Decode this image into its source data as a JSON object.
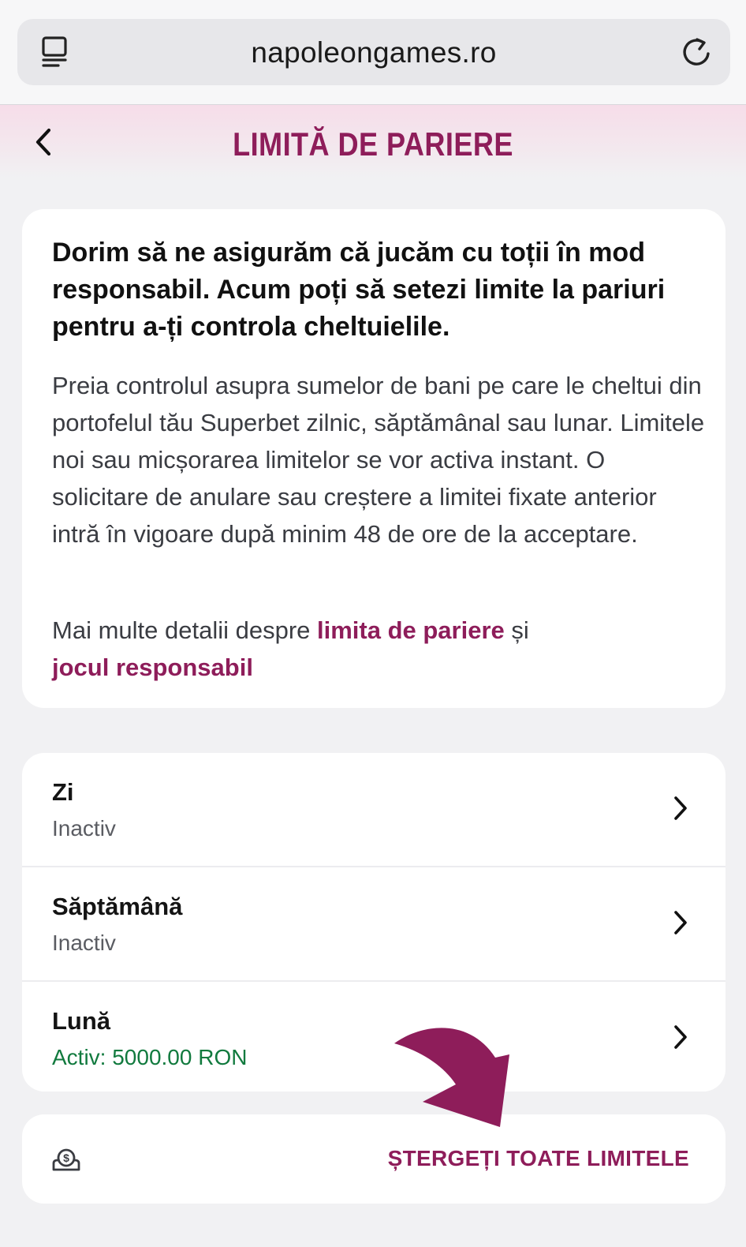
{
  "browser": {
    "url": "napoleongames.ro",
    "tabs_icon": "tabs-icon",
    "reload_icon": "reload-icon"
  },
  "header": {
    "title": "LIMITĂ DE PARIERE",
    "back_icon": "chevron-left-icon",
    "accent_color": "#8e1d5a"
  },
  "info": {
    "heading": "Dorim să ne asigurăm că jucăm cu toții în mod responsabil. Acum poți să setezi limite la pariuri pentru a-ți controla cheltuielile.",
    "body": "Preia controlul asupra sumelor de bani pe care le cheltui din portofelul tău Superbet zilnic, săptămânal sau lunar. Limitele noi sau micșorarea limitelor se vor activa instant. O solicitare de anulare sau creștere a limitei fixate anterior intră în vigoare după minim 48 de ore de la acceptare.",
    "more_prefix": "Mai multe detalii despre ",
    "link_betting_limit": "limita de pariere",
    "more_conjunction": " și",
    "link_responsible_gaming": "jocul responsabil"
  },
  "limits": [
    {
      "name": "Zi",
      "status": "Inactiv",
      "active": false
    },
    {
      "name": "Săptămână",
      "status": "Inactiv",
      "active": false
    },
    {
      "name": "Lună",
      "status": "Activ: 5000.00 RON",
      "active": true
    }
  ],
  "footer": {
    "icon": "money-bag-icon",
    "clear_all_label": "ȘTERGEȚI TOATE LIMITELE"
  },
  "colors": {
    "brand": "#8e1d5a",
    "active_status": "#117a3e",
    "inactive_status": "#5a5c62"
  }
}
